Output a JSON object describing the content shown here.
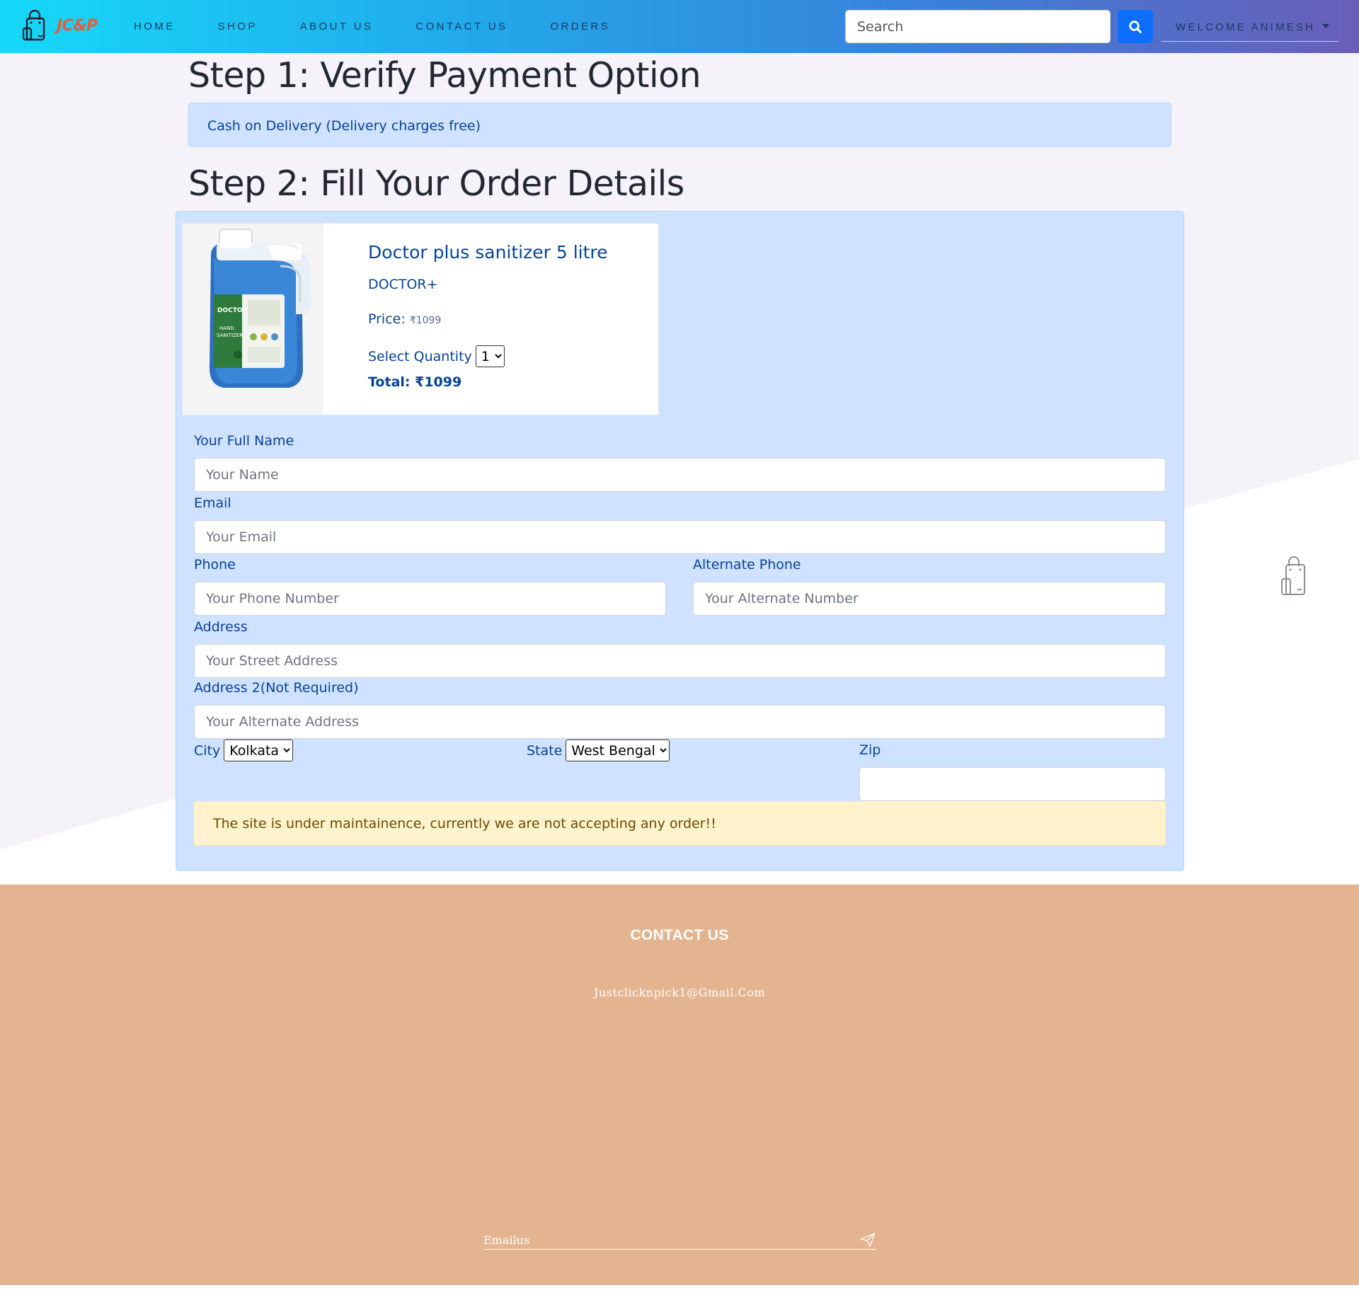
{
  "brand": {
    "text": "JC&P",
    "color": "#e35d3d"
  },
  "nav": {
    "links": [
      "HOME",
      "SHOP",
      "ABOUT US",
      "CONTACT US",
      "ORDERS"
    ],
    "search_placeholder": "Search",
    "welcome": "WELCOME ANIMESH"
  },
  "step1": {
    "title": "Step 1: Verify Payment Option",
    "payment_option": "Cash on Delivery (Delivery charges free)"
  },
  "step2": {
    "title": "Step 2: Fill Your Order Details"
  },
  "product": {
    "name": "Doctor plus sanitizer 5 litre",
    "brand": "DOCTOR+",
    "price_label": "Price:",
    "price_value": "₹1099",
    "quantity_label": "Select Quantity",
    "quantity_value": "1",
    "total": "Total: ₹1099"
  },
  "form": {
    "name_label": "Your Full Name",
    "name_placeholder": "Your Name",
    "email_label": "Email",
    "email_placeholder": "Your Email",
    "phone_label": "Phone",
    "phone_placeholder": "Your Phone Number",
    "alt_phone_label": "Alternate Phone",
    "alt_phone_placeholder": "Your Alternate Number",
    "address_label": "Address",
    "address_placeholder": "Your Street Address",
    "address2_label": "Address 2(Not Required)",
    "address2_placeholder": "Your Alternate Address",
    "city_label": "City",
    "city_value": "Kolkata",
    "state_label": "State",
    "state_value": "West Bengal",
    "zip_label": "Zip",
    "zip_value": ""
  },
  "maintenance_notice": "The site is under maintainence, currently we are not accepting any order!!",
  "footer": {
    "title": "CONTACT US",
    "email": "Justclicknpick1@Gmail.Com",
    "newsletter_placeholder": "Emailus"
  },
  "colors": {
    "nav_gradient": [
      "#16d9f8",
      "#22a8ea",
      "#3b7fd8",
      "#6a5eb8"
    ],
    "primary": "#0d6efd",
    "info_bg": "#cfe2ff",
    "warning_bg": "#fff3cd",
    "footer_bg": "#e4b38f"
  },
  "icons": [
    "shopping-bag-icon",
    "search-icon",
    "caret-down-icon",
    "paper-plane-icon"
  ]
}
